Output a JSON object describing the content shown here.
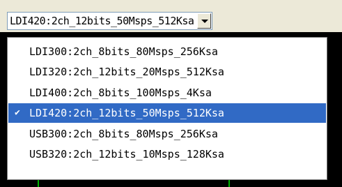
{
  "combo": {
    "value": "LDI420:2ch_12bits_50Msps_512Ksa",
    "button_icon": "chevron-down-icon"
  },
  "dropdown": {
    "items": [
      {
        "label": "LDI300:2ch_8bits_80Msps_256Ksa",
        "selected": false
      },
      {
        "label": "LDI320:2ch_12bits_20Msps_512Ksa",
        "selected": false
      },
      {
        "label": "LDI400:2ch_8bits_100Msps_4Ksa",
        "selected": false
      },
      {
        "label": "LDI420:2ch_12bits_50Msps_512Ksa",
        "selected": true
      },
      {
        "label": "USB300:2ch_8bits_80Msps_256Ksa",
        "selected": false
      },
      {
        "label": "USB320:2ch_12bits_10Msps_128Ksa",
        "selected": false
      }
    ],
    "check_glyph": "✔"
  },
  "colors": {
    "selection": "#316ac5",
    "backdrop": "#000000",
    "trace": "#00b400"
  }
}
